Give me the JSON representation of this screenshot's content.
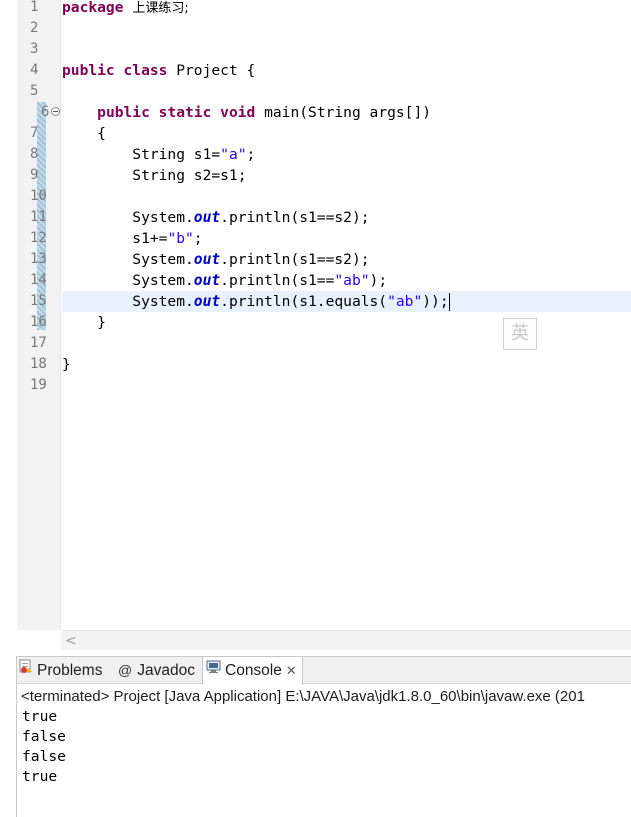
{
  "editor": {
    "line_numbers": [
      "1",
      "2",
      "3",
      "4",
      "5",
      "6",
      "7",
      "8",
      "9",
      "10",
      "11",
      "12",
      "13",
      "14",
      "15",
      "16",
      "17",
      "18",
      "19"
    ],
    "code": {
      "l1_kw": "package",
      "l1_name": "上课练习;",
      "l4_kw": "public class",
      "l4_rest": " Project {",
      "l6_indent": "    ",
      "l6_kw": "public static void",
      "l6_rest": " main(String args[])",
      "l7": "    {",
      "l8_a": "        String s1=",
      "l8_str": "\"a\"",
      "l8_b": ";",
      "l9": "        String s2=s1;",
      "l11_a": "        System.",
      "l11_fld": "out",
      "l11_b": ".println(s1==s2);",
      "l12_a": "        s1+=",
      "l12_str": "\"b\"",
      "l12_b": ";",
      "l13_a": "        System.",
      "l13_fld": "out",
      "l13_b": ".println(s1==s2);",
      "l14_a": "        System.",
      "l14_fld": "out",
      "l14_b": ".println(s1==",
      "l14_str": "\"ab\"",
      "l14_c": ");",
      "l15_a": "        System.",
      "l15_fld": "out",
      "l15_b": ".println(s1.equals(",
      "l15_str": "\"ab\"",
      "l15_c": "));",
      "l16": "    }",
      "l18": "}"
    },
    "ime_indicator": "英",
    "scroll_left_glyph": "<"
  },
  "panel": {
    "tabs": [
      {
        "label": "Problems"
      },
      {
        "label": "Javadoc",
        "icon_glyph": "@"
      },
      {
        "label": "Console",
        "close_glyph": "✕"
      }
    ],
    "console_header": "<terminated> Project [Java Application] E:\\JAVA\\Java\\jdk1.8.0_60\\bin\\javaw.exe (201",
    "output": [
      "true",
      "false",
      "false",
      "true"
    ]
  },
  "colors": {
    "keyword": "#7f0055",
    "string": "#2a00ff",
    "field": "#0000c0",
    "current_line": "#e8f2fe"
  },
  "icons": [
    "fold-collapse-icon",
    "problems-icon",
    "javadoc-icon",
    "console-icon",
    "close-icon"
  ]
}
